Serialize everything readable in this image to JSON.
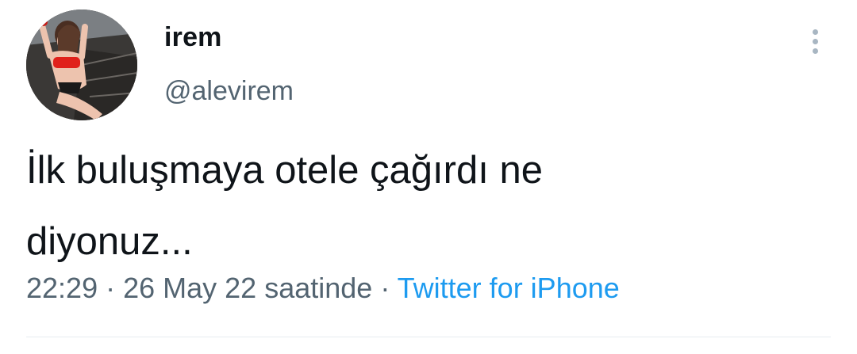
{
  "user": {
    "display_name": "irem",
    "handle": "@alevirem"
  },
  "tweet": {
    "text": "İlk buluşmaya otele çağırdı ne\ndiyonuz...",
    "time": "22:29",
    "separator_1": " · ",
    "date": "26 May 22 saatinde",
    "separator_2": " · ",
    "source": "Twitter for iPhone"
  },
  "icons": {
    "more": "more-vertical-icon",
    "avatar": "profile-photo"
  },
  "colors": {
    "text_primary": "#0f1419",
    "text_secondary": "#536471",
    "accent": "#1d9bf0",
    "divider": "#e6ecf0"
  }
}
